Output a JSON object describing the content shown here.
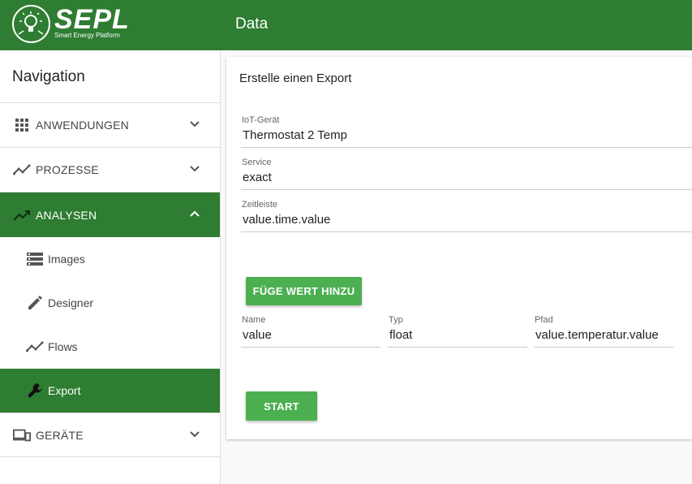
{
  "header": {
    "logo_title": "SEPL",
    "logo_subtitle": "Smart Energy Platform",
    "page_title": "Data",
    "color": "#2e7d32"
  },
  "sidebar": {
    "title": "Navigation",
    "items": [
      {
        "label": "ANWENDUNGEN",
        "icon": "apps-grid-icon",
        "expanded": false
      },
      {
        "label": "PROZESSE",
        "icon": "timeline-icon",
        "expanded": false
      },
      {
        "label": "ANALYSEN",
        "icon": "trending-up-icon",
        "expanded": true,
        "children": [
          {
            "label": "Images",
            "icon": "storage-icon"
          },
          {
            "label": "Designer",
            "icon": "pencil-icon"
          },
          {
            "label": "Flows",
            "icon": "timeline-icon"
          },
          {
            "label": "Export",
            "icon": "wrench-icon",
            "active": true
          }
        ]
      },
      {
        "label": "GERÄTE",
        "icon": "devices-icon",
        "expanded": false
      }
    ]
  },
  "form": {
    "title": "Erstelle einen Export",
    "device": {
      "label": "IoT-Gerät",
      "value": "Thermostat 2 Temp"
    },
    "service": {
      "label": "Service",
      "value": "exact"
    },
    "timeline": {
      "label": "Zeitleiste",
      "value": "value.time.value"
    },
    "add_value_button": "FÜGE WERT HINZU",
    "row": {
      "name": {
        "label": "Name",
        "value": "value"
      },
      "type": {
        "label": "Typ",
        "value": "float"
      },
      "path": {
        "label": "Pfad",
        "value": "value.temperatur.value"
      }
    },
    "start_button": "START"
  }
}
